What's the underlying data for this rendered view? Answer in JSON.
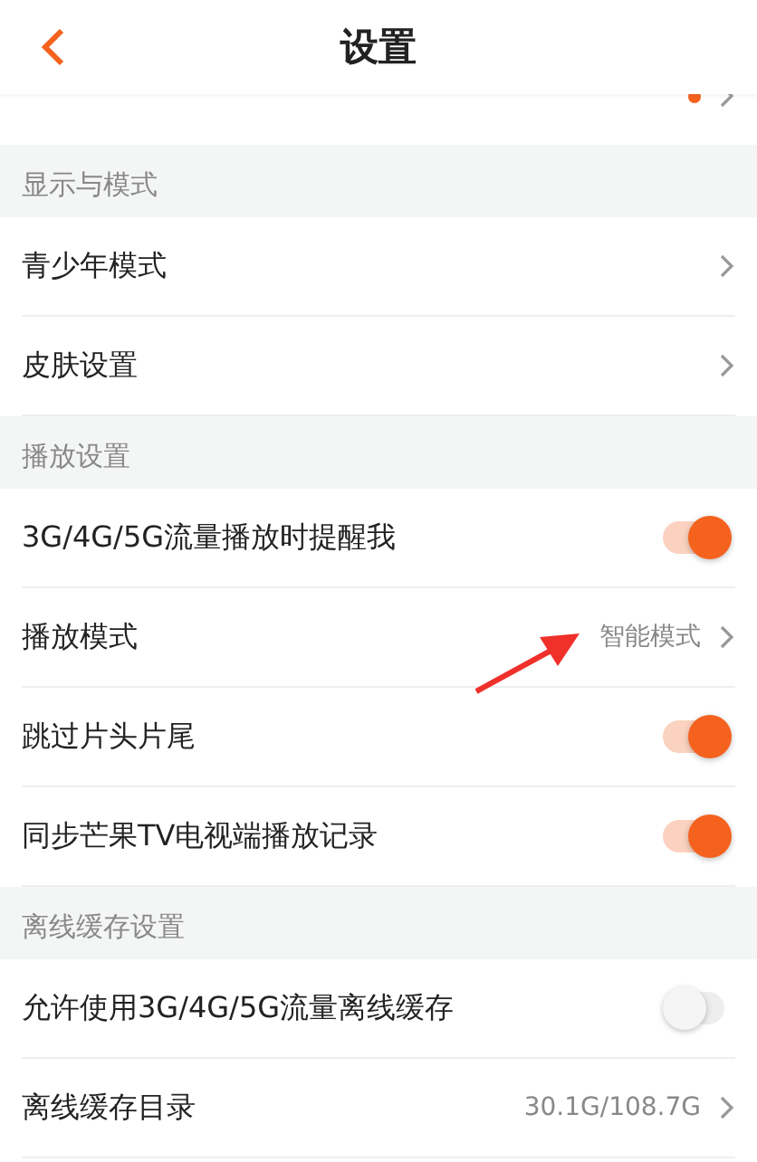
{
  "header": {
    "title": "设置"
  },
  "sections": [
    {
      "rows": [
        {
          "kind": "link",
          "dot": true,
          "cut": true
        }
      ]
    },
    {
      "title": "显示与模式",
      "rows": [
        {
          "kind": "link",
          "label": "青少年模式"
        },
        {
          "kind": "link",
          "label": "皮肤设置"
        }
      ]
    },
    {
      "title": "播放设置",
      "rows": [
        {
          "kind": "toggle",
          "label": "3G/4G/5G流量播放时提醒我",
          "on": true
        },
        {
          "kind": "link",
          "label": "播放模式",
          "value": "智能模式"
        },
        {
          "kind": "toggle",
          "label": "跳过片头片尾",
          "on": true
        },
        {
          "kind": "toggle",
          "label": "同步芒果TV电视端播放记录",
          "on": true
        }
      ]
    },
    {
      "title": "离线缓存设置",
      "rows": [
        {
          "kind": "toggle",
          "label": "允许使用3G/4G/5G流量离线缓存",
          "on": false
        },
        {
          "kind": "link",
          "label": "离线缓存目录",
          "value": "30.1G/108.7G"
        }
      ]
    }
  ]
}
